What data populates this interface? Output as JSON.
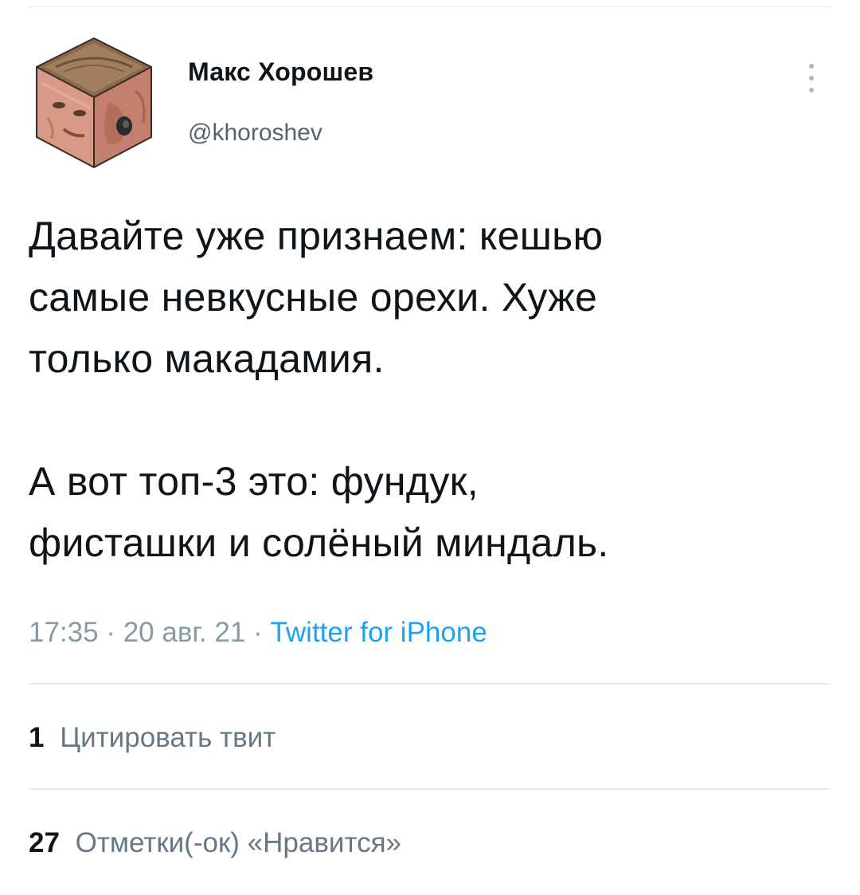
{
  "author": {
    "display_name": "Макс Хорошев",
    "handle": "@khoroshev",
    "avatar_icon": "cube-face-avatar"
  },
  "more_icon": "vertical-dots-icon",
  "tweet": {
    "paragraphs": [
      "Давайте уже признаем: кешью\nсамые невкусные орехи. Хуже\nтолько макадамия.",
      "А вот топ-3 это: фундук,\nфисташки и солёный миндаль."
    ]
  },
  "meta": {
    "time": "17:35",
    "separator": "·",
    "date": "20 авг. 21",
    "source": "Twitter for iPhone"
  },
  "stats": {
    "quotes_count": "1",
    "quotes_label": "Цитировать твит",
    "likes_count": "27",
    "likes_label": "Отметки(-ок) «Нравится»"
  },
  "colors": {
    "text": "#0f1419",
    "secondary": "#8899a6",
    "link": "#1da1f2",
    "divider": "#e6ecf0"
  }
}
